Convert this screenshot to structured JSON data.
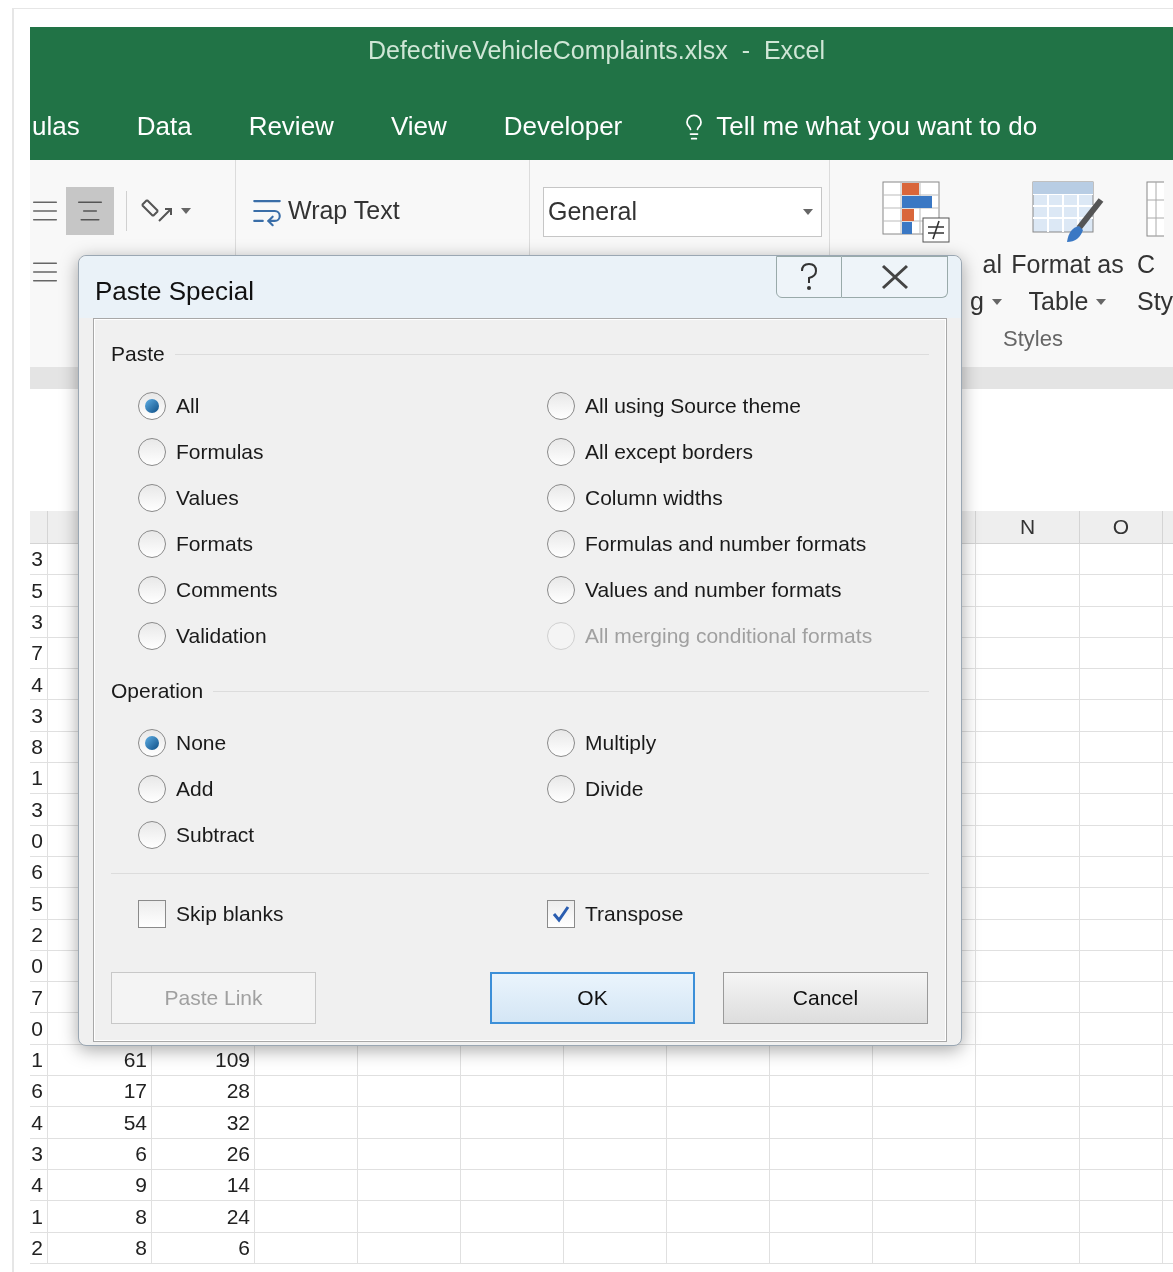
{
  "window": {
    "title": "DefectiveVehicleComplaints.xlsx  -  Excel"
  },
  "tabs": [
    {
      "label": "ulas",
      "selected": false
    },
    {
      "label": "Data",
      "selected": false
    },
    {
      "label": "Review",
      "selected": false
    },
    {
      "label": "View",
      "selected": false
    },
    {
      "label": "Developer",
      "selected": false
    }
  ],
  "tell_me": "Tell me what you want to do",
  "ribbon": {
    "wrap_text": "Wrap Text",
    "number_format": "General",
    "style_buttons": [
      {
        "line1": "al",
        "line2": "g"
      },
      {
        "line1": "Format as",
        "line2": "Table"
      },
      {
        "line1": "C",
        "line2": "Sty"
      }
    ],
    "styles_group": "Styles"
  },
  "sheet": {
    "columns": [
      "N",
      "O"
    ],
    "rows": [
      {
        "cells": [
          "3"
        ]
      },
      {
        "cells": [
          "5"
        ]
      },
      {
        "cells": [
          "3"
        ]
      },
      {
        "cells": [
          "7"
        ]
      },
      {
        "cells": [
          "4"
        ]
      },
      {
        "cells": [
          "3"
        ]
      },
      {
        "cells": [
          "8"
        ]
      },
      {
        "cells": [
          "1"
        ]
      },
      {
        "cells": [
          "3"
        ]
      },
      {
        "cells": [
          "0"
        ]
      },
      {
        "cells": [
          "6"
        ]
      },
      {
        "cells": [
          "5"
        ]
      },
      {
        "cells": [
          "2"
        ]
      },
      {
        "cells": [
          "0"
        ]
      },
      {
        "cells": [
          "7"
        ]
      },
      {
        "cells": [
          "0"
        ]
      },
      {
        "cells": [
          "1",
          "61",
          "109"
        ]
      },
      {
        "cells": [
          "6",
          "17",
          "28"
        ]
      },
      {
        "cells": [
          "4",
          "54",
          "32"
        ]
      },
      {
        "cells": [
          "3",
          "6",
          "26"
        ]
      },
      {
        "cells": [
          "4",
          "9",
          "14"
        ]
      },
      {
        "cells": [
          "1",
          "8",
          "24"
        ]
      },
      {
        "cells": [
          "2",
          "8",
          "6"
        ]
      }
    ]
  },
  "dialog": {
    "title": "Paste Special",
    "paste": {
      "label": "Paste",
      "left": [
        {
          "label": "All",
          "selected": true,
          "disabled": false
        },
        {
          "label": "Formulas",
          "selected": false,
          "disabled": false
        },
        {
          "label": "Values",
          "selected": false,
          "disabled": false
        },
        {
          "label": "Formats",
          "selected": false,
          "disabled": false
        },
        {
          "label": "Comments",
          "selected": false,
          "disabled": false
        },
        {
          "label": "Validation",
          "selected": false,
          "disabled": false
        }
      ],
      "right": [
        {
          "label": "All using Source theme",
          "selected": false,
          "disabled": false
        },
        {
          "label": "All except borders",
          "selected": false,
          "disabled": false
        },
        {
          "label": "Column widths",
          "selected": false,
          "disabled": false
        },
        {
          "label": "Formulas and number formats",
          "selected": false,
          "disabled": false
        },
        {
          "label": "Values and number formats",
          "selected": false,
          "disabled": false
        },
        {
          "label": "All merging conditional formats",
          "selected": false,
          "disabled": true
        }
      ]
    },
    "operation": {
      "label": "Operation",
      "left": [
        {
          "label": "None",
          "selected": true,
          "disabled": false
        },
        {
          "label": "Add",
          "selected": false,
          "disabled": false
        },
        {
          "label": "Subtract",
          "selected": false,
          "disabled": false
        }
      ],
      "right": [
        {
          "label": "Multiply",
          "selected": false,
          "disabled": false
        },
        {
          "label": "Divide",
          "selected": false,
          "disabled": false
        }
      ]
    },
    "checkboxes": [
      {
        "label": "Skip blanks",
        "checked": false
      },
      {
        "label": "Transpose",
        "checked": true
      }
    ],
    "buttons": [
      {
        "label": "Paste Link",
        "disabled": true,
        "default": false
      },
      {
        "label": "OK",
        "disabled": false,
        "default": true
      },
      {
        "label": "Cancel",
        "disabled": false,
        "default": false
      }
    ]
  }
}
